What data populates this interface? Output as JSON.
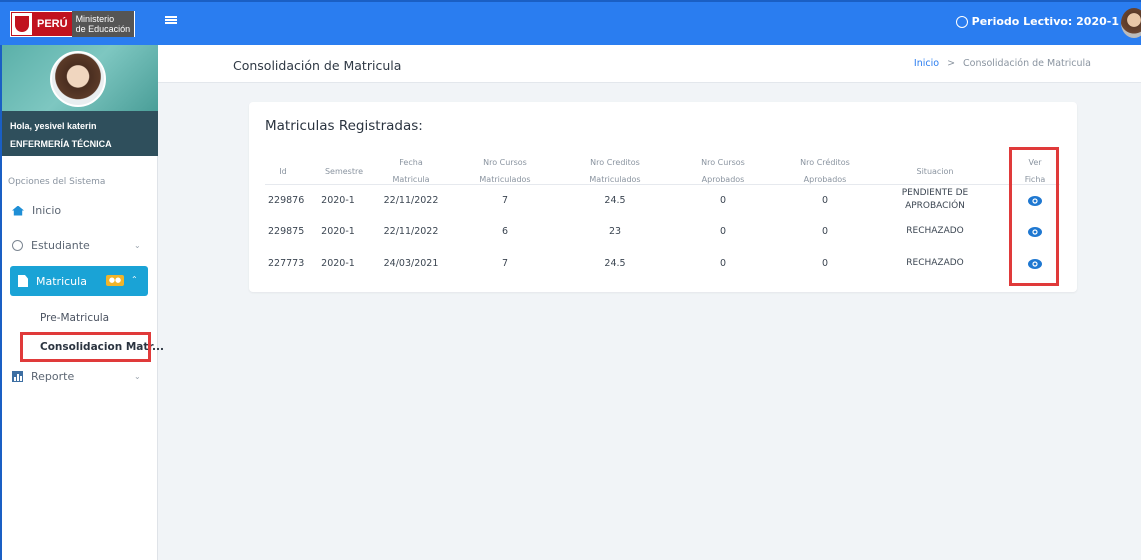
{
  "header": {
    "logo_peru": "PERÚ",
    "logo_min_1": "Ministerio",
    "logo_min_2": "de Educación",
    "periodo": "Periodo Lectivo: 2020-1"
  },
  "sidebar": {
    "greeting": "Hola, yesivel katerin",
    "career": "ENFERMERÍA TÉCNICA",
    "section_label": "Opciones del Sistema",
    "items": [
      {
        "label": "Inicio",
        "icon": "home-icon"
      },
      {
        "label": "Estudiante",
        "icon": "student-icon"
      },
      {
        "label": "Matricula",
        "icon": "document-icon",
        "badge": "●●"
      },
      {
        "label": "Reporte",
        "icon": "report-icon"
      }
    ],
    "submenu": [
      {
        "label": "Pre-Matricula"
      },
      {
        "label": "Consolidacion Matr..."
      }
    ]
  },
  "page": {
    "title": "Consolidación de Matricula",
    "breadcrumb_home": "Inicio",
    "breadcrumb_sep": ">",
    "breadcrumb_current": "Consolidación de Matricula",
    "card_title": "Matriculas Registradas:"
  },
  "table": {
    "headers": [
      [
        "Id",
        ""
      ],
      [
        "Semestre",
        ""
      ],
      [
        "Fecha",
        "Matricula"
      ],
      [
        "Nro Cursos",
        "Matriculados"
      ],
      [
        "Nro Creditos",
        "Matriculados"
      ],
      [
        "Nro Cursos",
        "Aprobados"
      ],
      [
        "Nro Créditos",
        "Aprobados"
      ],
      [
        "Situacion",
        ""
      ],
      [
        "Ver",
        "Ficha"
      ]
    ],
    "rows": [
      {
        "id": "229876",
        "semestre": "2020-1",
        "fecha": "22/11/2022",
        "cursos_mat": "7",
        "creditos_mat": "24.5",
        "cursos_apr": "0",
        "creditos_apr": "0",
        "situacion_1": "PENDIENTE DE",
        "situacion_2": "APROBACIÓN"
      },
      {
        "id": "229875",
        "semestre": "2020-1",
        "fecha": "22/11/2022",
        "cursos_mat": "6",
        "creditos_mat": "23",
        "cursos_apr": "0",
        "creditos_apr": "0",
        "situacion_1": "RECHAZADO",
        "situacion_2": ""
      },
      {
        "id": "227773",
        "semestre": "2020-1",
        "fecha": "24/03/2021",
        "cursos_mat": "7",
        "creditos_mat": "24.5",
        "cursos_apr": "0",
        "creditos_apr": "0",
        "situacion_1": "RECHAZADO",
        "situacion_2": ""
      }
    ]
  },
  "colors": {
    "topbar": "#2a7df0",
    "active_menu": "#1aa3d6",
    "eye_icon": "#1f78d1",
    "highlight": "#e03a3a"
  }
}
